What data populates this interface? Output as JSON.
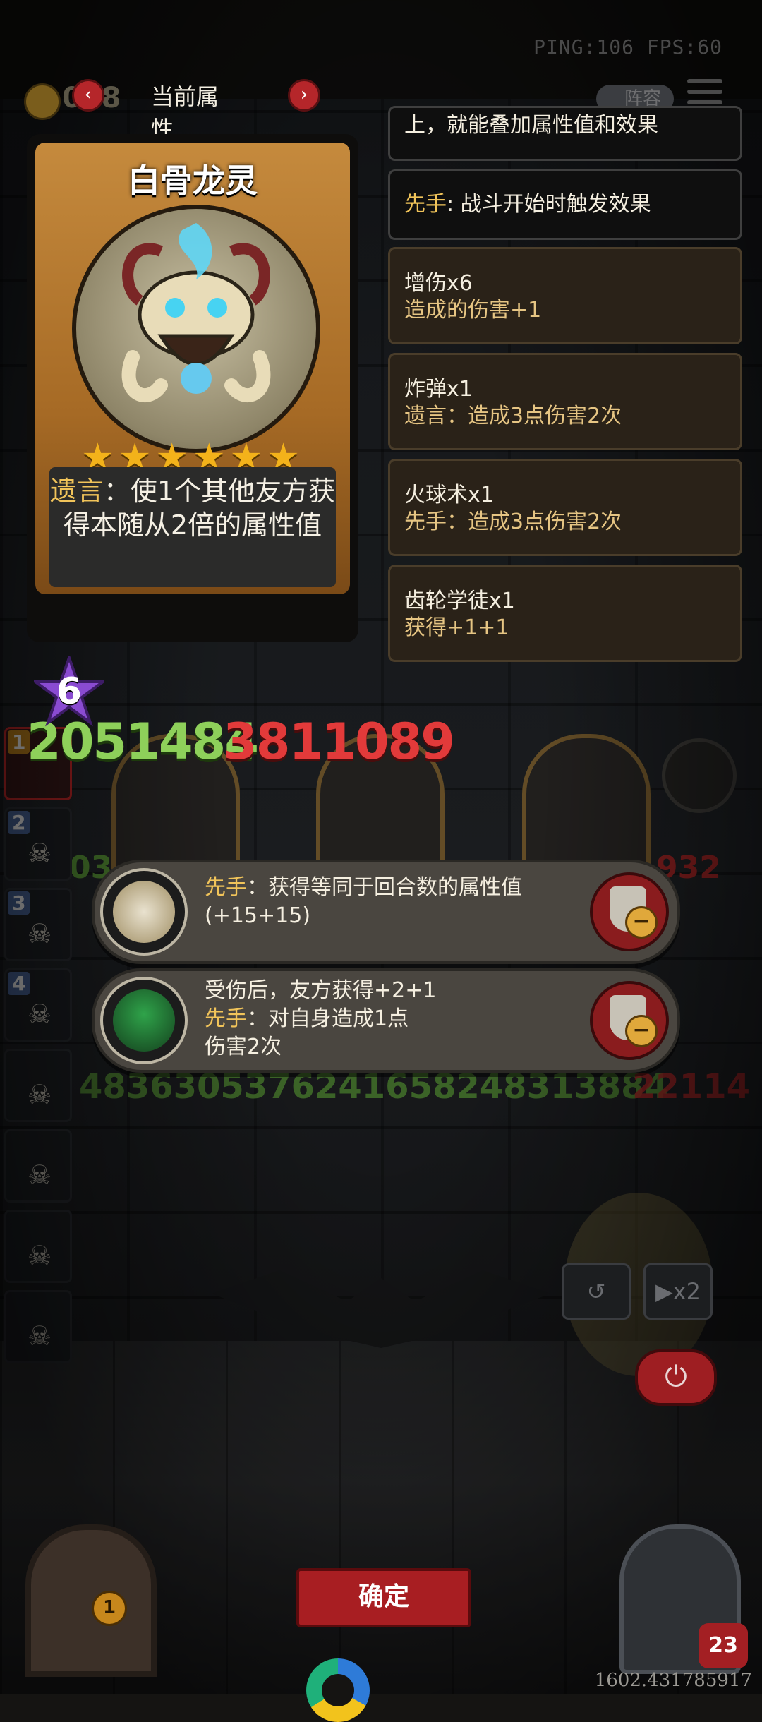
{
  "hud": {
    "ping_fps": "PING:106 FPS:60",
    "gold": "018",
    "title": "当前属性",
    "prev": "‹",
    "next": "›",
    "lineup": "阵容"
  },
  "card": {
    "name": "白骨龙灵",
    "stars": "★★★★★★",
    "desc_keyword": "遗言",
    "desc_rest": "：使1个其他友方获得本随从2倍的属性值",
    "attack": "2051484",
    "health": "3811089",
    "tier": "6"
  },
  "effects": [
    {
      "line1": "上，就能叠加属性值和效果",
      "line2": ""
    },
    {
      "keyword": "先手",
      "line1": ": 战斗开始时触发效果"
    },
    {
      "line1": "增伤x6",
      "line2": "造成的伤害+1"
    },
    {
      "line1": "炸弹x1",
      "line2": "遗言：造成3点伤害2次"
    },
    {
      "line1": "火球术x1",
      "line2": "先手：造成3点伤害2次"
    },
    {
      "line1": "齿轮学徒x1",
      "line2": "获得+1+1"
    }
  ],
  "side_list": [
    {
      "num": "1"
    },
    {
      "num": "2"
    },
    {
      "num": "3"
    },
    {
      "num": "4"
    }
  ],
  "board_numbers": {
    "left_partial": "03",
    "right_partial": "932",
    "row": "4836305376241658248313884",
    "row_red": "22114"
  },
  "popups": [
    {
      "keyword": "先手",
      "text": "：获得等同于回合数的属性值",
      "text2": "(+15+15)"
    },
    {
      "line_a": "受伤后，友方获得+2+1",
      "keyword": "先手",
      "text": "：对自身造成1点",
      "text2": "伤害2次"
    }
  ],
  "controls": {
    "speed": "▶x2",
    "undo": "↺",
    "power": "⏻"
  },
  "confirm": "确定",
  "bottom": {
    "door_badge": "1",
    "hero_health": "23",
    "coords": "1602.431785917"
  }
}
